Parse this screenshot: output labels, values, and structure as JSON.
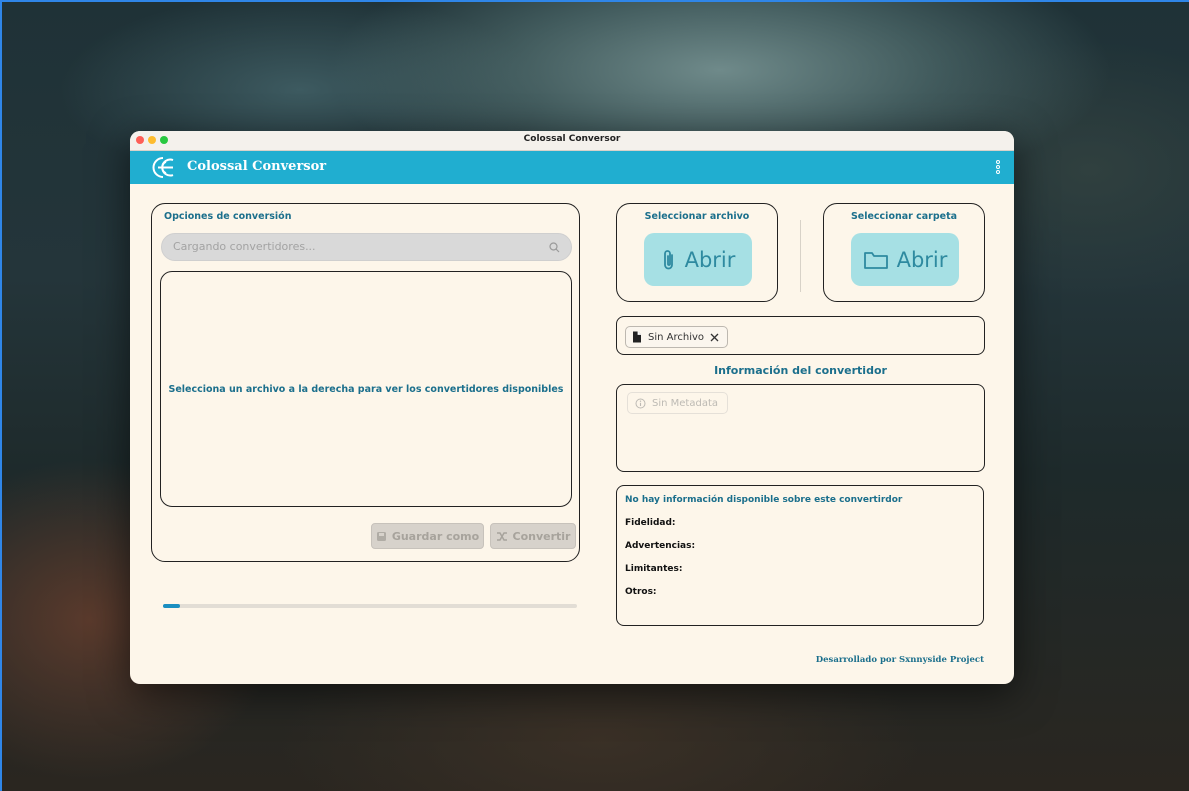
{
  "window": {
    "title": "Colossal Conversor"
  },
  "appbar": {
    "app_name": "Colossal Conversor",
    "menu_icon": "kebab-icon",
    "accent": "#20aed0"
  },
  "options": {
    "heading": "Opciones de conversión",
    "search_placeholder": "Cargando convertidores...",
    "empty_message": "Selecciona un archivo a la derecha para ver los convertidores disponibles",
    "save_label": "Guardar como",
    "convert_label": "Convertir",
    "progress": 0.01
  },
  "select_file": {
    "label": "Seleccionar archivo",
    "button": "Abrir",
    "icon": "paperclip-icon"
  },
  "select_folder": {
    "label": "Seleccionar carpeta",
    "button": "Abrir",
    "icon": "folder-icon"
  },
  "file": {
    "chip_label": "Sin Archivo"
  },
  "converter_info": {
    "title": "Información del convertidor",
    "metadata_chip": "Sin Metadata",
    "details_title": "No hay información disponible sobre este convertirdor",
    "fidelity_label": "Fidelidad:",
    "warnings_label": "Advertencias:",
    "limits_label": "Limitantes:",
    "others_label": "Otros:"
  },
  "footer": {
    "credit": "Desarrollado por Sxnnyside Project"
  }
}
